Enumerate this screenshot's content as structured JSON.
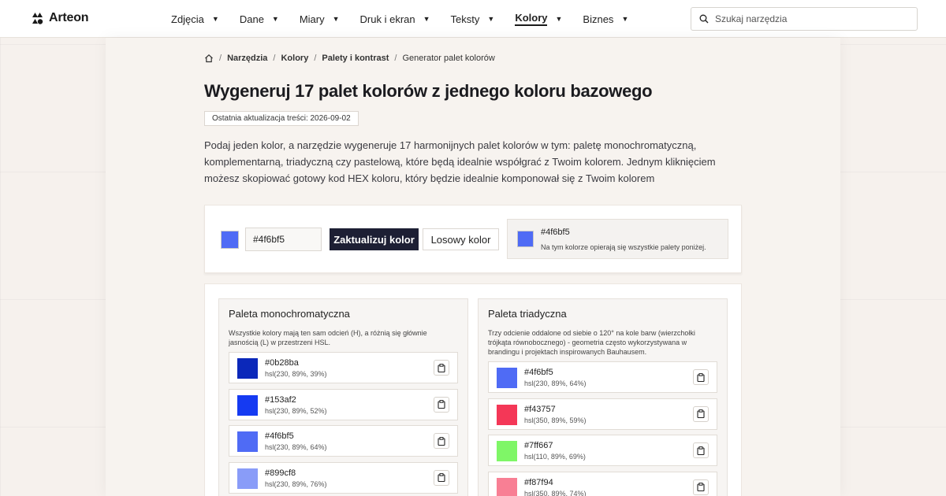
{
  "header": {
    "brand": "Arteon",
    "nav": [
      {
        "label": "Zdjęcia",
        "active": false
      },
      {
        "label": "Dane",
        "active": false
      },
      {
        "label": "Miary",
        "active": false
      },
      {
        "label": "Druk i ekran",
        "active": false
      },
      {
        "label": "Teksty",
        "active": false
      },
      {
        "label": "Kolory",
        "active": true
      },
      {
        "label": "Biznes",
        "active": false
      }
    ],
    "search_placeholder": "Szukaj narzędzia"
  },
  "breadcrumb": [
    "Narzędzia",
    "Kolory",
    "Palety i kontrast",
    "Generator palet kolorów"
  ],
  "page": {
    "title": "Wygeneruj 17 palet kolorów z jednego koloru bazowego",
    "updated": "Ostatnia aktualizacja treści: 2026-09-02",
    "intro": "Podaj jeden kolor, a narzędzie wygeneruje 17 harmonijnych palet kolorów w tym: paletę monochromatyczną, komplementarną, triadyczną czy pastelową, które będą idealnie współgrać z Twoim kolorem. Jednym kliknięciem możesz skopiować gotowy kod HEX koloru, który będzie idealnie komponował się z Twoim kolorem"
  },
  "controls": {
    "color_value": "#4f6bf5",
    "update_label": "Zaktualizuj kolor",
    "random_label": "Losowy kolor",
    "current_hex": "#4f6bf5",
    "current_desc": "Na tym kolorze opierają się wszystkie palety poniżej."
  },
  "colors": {
    "base": "#4f6bf5",
    "primary_button": "#1d1f34"
  },
  "palettes": [
    {
      "title": "Paleta monochromatyczna",
      "desc": "Wszystkie kolory mają ten sam odcień (H), a różnią się głównie jasnością (L) w przestrzeni HSL.",
      "colors": [
        {
          "hex": "#0b28ba",
          "hsl": "hsl(230, 89%, 39%)"
        },
        {
          "hex": "#153af2",
          "hsl": "hsl(230, 89%, 52%)"
        },
        {
          "hex": "#4f6bf5",
          "hsl": "hsl(230, 89%, 64%)"
        },
        {
          "hex": "#899cf8",
          "hsl": "hsl(230, 89%, 76%)"
        }
      ]
    },
    {
      "title": "Paleta triadyczna",
      "desc": "Trzy odcienie oddalone od siebie o 120° na kole barw (wierzchołki trójkąta równobocznego) - geometria często wykorzystywana w brandingu i projektach inspirowanych Bauhausem.",
      "colors": [
        {
          "hex": "#4f6bf5",
          "hsl": "hsl(230, 89%, 64%)"
        },
        {
          "hex": "#f43757",
          "hsl": "hsl(350, 89%, 59%)"
        },
        {
          "hex": "#7ff667",
          "hsl": "hsl(110, 89%, 69%)"
        },
        {
          "hex": "#f87f94",
          "hsl": "hsl(350, 89%, 74%)"
        }
      ]
    }
  ]
}
